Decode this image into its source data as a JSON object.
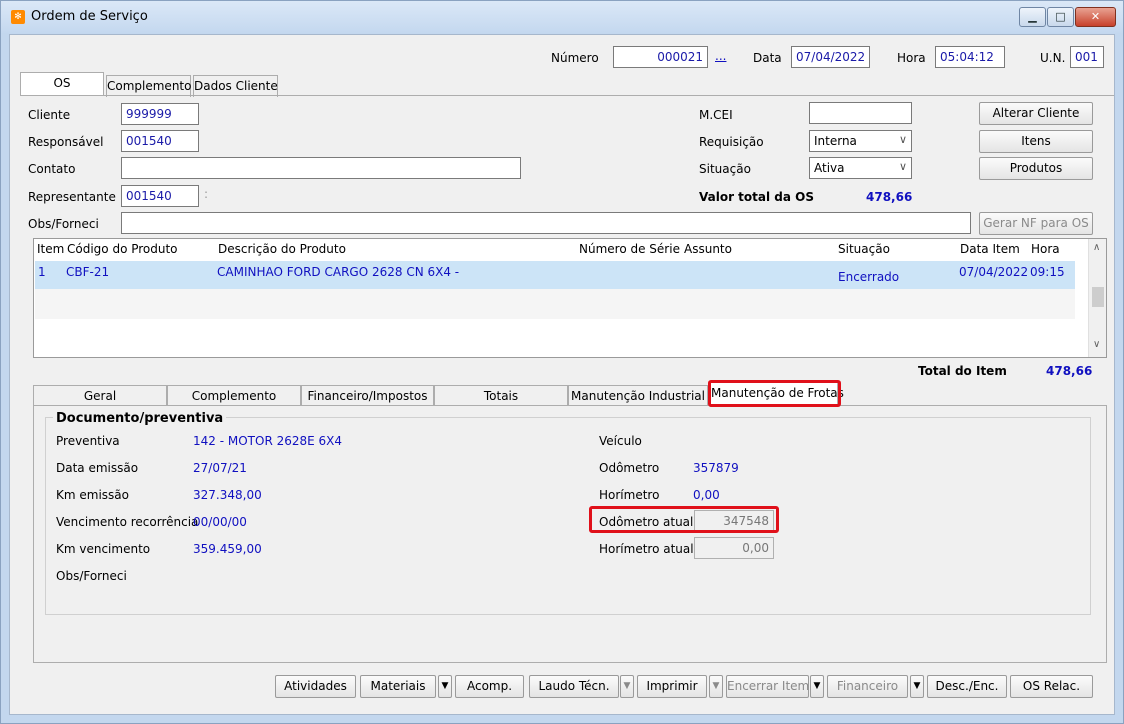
{
  "window": {
    "title": "Ordem de Serviço",
    "icon": "app-icon"
  },
  "header": {
    "numero_label": "Número",
    "numero_value": "000021",
    "numero_lookup": "...",
    "data_label": "Data",
    "data_value": "07/04/2022",
    "hora_label": "Hora",
    "hora_value": "05:04:12",
    "un_label": "U.N.",
    "un_value": "001"
  },
  "main_tabs": [
    "OS",
    "Complemento",
    "Dados Cliente"
  ],
  "form": {
    "cliente_label": "Cliente",
    "cliente_value": "999999",
    "responsavel_label": "Responsável",
    "responsavel_value": "001540",
    "contato_label": "Contato",
    "contato_value": "",
    "representante_label": "Representante",
    "representante_value": "001540",
    "representante_sep": ":",
    "obs_label": "Obs/Forneci",
    "obs_value": "",
    "mcei_label": "M.CEI",
    "mcei_value": "",
    "requisicao_label": "Requisição",
    "requisicao_value": "Interna",
    "situacao_label": "Situação",
    "situacao_value": "Ativa",
    "valor_total_label": "Valor total da OS",
    "valor_total_value": "478,66"
  },
  "actions": {
    "alterar_cliente": "Alterar Cliente",
    "itens": "Itens",
    "produtos": "Produtos",
    "gerar_nf": "Gerar NF para OS"
  },
  "grid": {
    "columns": [
      "Item",
      "Código do Produto",
      "Descrição do Produto",
      "Número de Série",
      "Assunto",
      "Situação",
      "Data Item",
      "Hora"
    ],
    "rows": [
      [
        "1",
        "CBF-21",
        "CAMINHAO FORD CARGO 2628 CN 6X4 -",
        "",
        "",
        "Encerrado",
        "07/04/2022",
        "09:15"
      ]
    ]
  },
  "total_item": {
    "label": "Total do Item",
    "value": "478,66"
  },
  "sub_tabs": [
    "Geral",
    "Complemento",
    "Financeiro/Impostos",
    "Totais",
    "Manutenção Industrial",
    "Manutenção de Frotas"
  ],
  "frotas": {
    "group_title": "Documento/preventiva",
    "preventiva_label": "Preventiva",
    "preventiva_value": "142 - MOTOR 2628E 6X4",
    "data_emissao_label": "Data emissão",
    "data_emissao_value": "27/07/21",
    "km_emissao_label": "Km emissão",
    "km_emissao_value": "327.348,00",
    "venc_recorrencia_label": "Vencimento recorrência",
    "venc_recorrencia_value": "00/00/00",
    "km_vencimento_label": "Km vencimento",
    "km_vencimento_value": "359.459,00",
    "obs_label": "Obs/Forneci",
    "veiculo_label": "Veículo",
    "veiculo_value": "",
    "odometro_label": "Odômetro",
    "odometro_value": "357879",
    "horimetro_label": "Horímetro",
    "horimetro_value": "0,00",
    "odometro_atual_label": "Odômetro atual",
    "odometro_atual_value": "347548",
    "horimetro_atual_label": "Horímetro atual",
    "horimetro_atual_value": "0,00"
  },
  "bottom_buttons": {
    "atividades": "Atividades",
    "materiais": "Materiais",
    "acomp": "Acomp.",
    "laudo": "Laudo Técn.",
    "imprimir": "Imprimir",
    "encerrar": "Encerrar Item",
    "financeiro": "Financeiro",
    "desc_enc": "Desc./Enc.",
    "os_relac": "OS Relac."
  },
  "colors": {
    "highlight": "#e0101a",
    "value_blue": "#1010c0",
    "selected_row": "#cce4f7"
  }
}
